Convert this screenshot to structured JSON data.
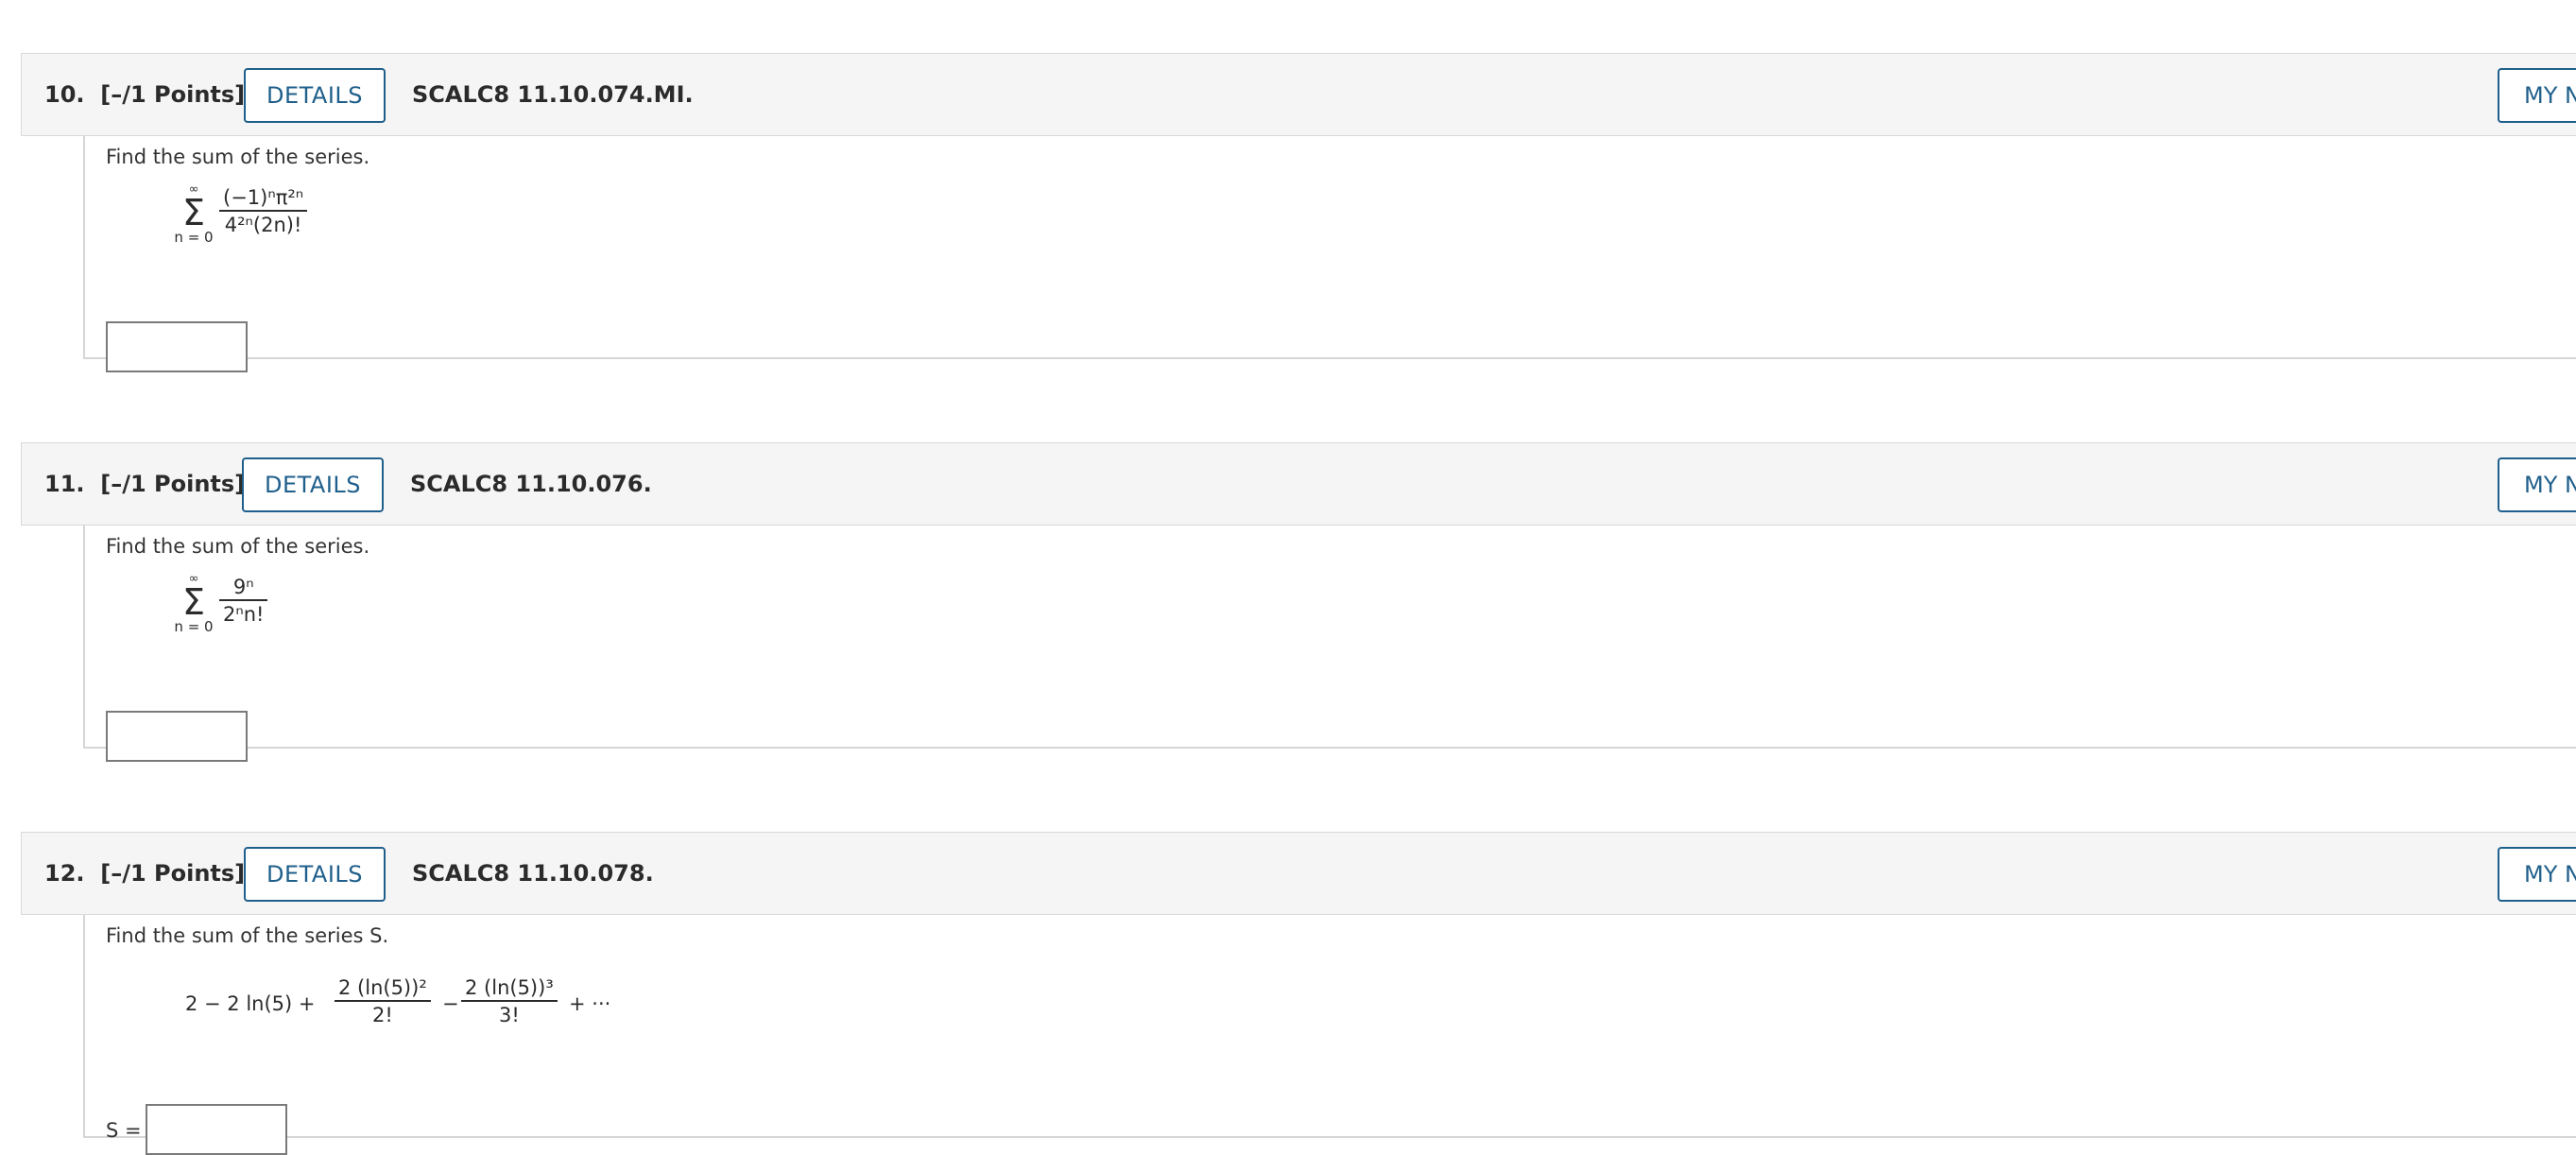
{
  "questions": [
    {
      "number": "10.",
      "points": "[–/1 Points]",
      "details_label": "DETAILS",
      "code": "SCALC8 11.10.074.MI.",
      "my_notes_label": "MY NOTES",
      "prompt": "Find the sum of the series.",
      "sum_upper": "∞",
      "sum_lower": "n = 0",
      "numerator": "(−1)ⁿπ²ⁿ",
      "denominator": "4²ⁿ(2n)!",
      "answer_value": ""
    },
    {
      "number": "11.",
      "points": "[–/1 Points]",
      "details_label": "DETAILS",
      "code": "SCALC8 11.10.076.",
      "my_notes_label": "MY NOTES",
      "prompt": "Find the sum of the series.",
      "sum_upper": "∞",
      "sum_lower": "n = 0",
      "numerator": "9ⁿ",
      "denominator": "2ⁿn!",
      "answer_value": ""
    },
    {
      "number": "12.",
      "points": "[–/1 Points]",
      "details_label": "DETAILS",
      "code": "SCALC8 11.10.078.",
      "my_notes_label": "MY NOTES",
      "prompt": "Find the sum of the series S.",
      "series_lead": "2 − 2 ln(5) +",
      "term2_num": "2 (ln(5))²",
      "term2_den": "2!",
      "minus": "−",
      "term3_num": "2 (ln(5))³",
      "term3_den": "3!",
      "series_tail": "+ ···",
      "answer_label": "S =",
      "answer_value": ""
    }
  ],
  "colors": {
    "accent": "#1f5f8b",
    "header_bg": "#f5f5f5",
    "border": "#d9d9d9"
  }
}
